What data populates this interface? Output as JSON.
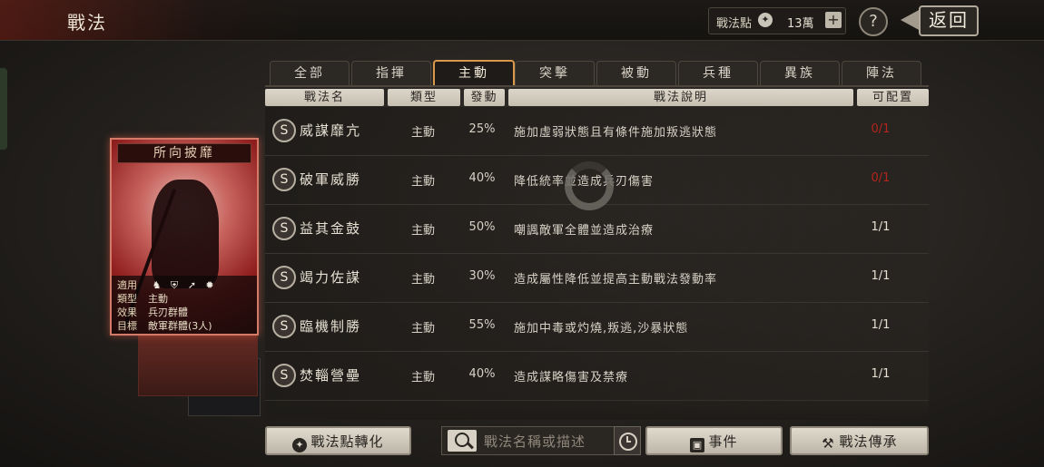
{
  "header": {
    "title": "戰法",
    "points_label": "戰法點",
    "points_value": "13萬",
    "plus_label": "+",
    "help_label": "?",
    "back_label": "返回"
  },
  "tabs": [
    {
      "label": "全部"
    },
    {
      "label": "指揮"
    },
    {
      "label": "主動"
    },
    {
      "label": "突擊"
    },
    {
      "label": "被動"
    },
    {
      "label": "兵種"
    },
    {
      "label": "異族"
    },
    {
      "label": "陣法"
    }
  ],
  "active_tab": "主動",
  "columns": {
    "name": "戰法名",
    "type": "類型",
    "rate": "發動",
    "desc": "戰法說明",
    "avail": "可配置"
  },
  "rows": [
    {
      "badge": "S",
      "name": "威謀靡亢",
      "type": "主動",
      "rate": "25%",
      "desc": "施加虛弱狀態且有條件施加叛逃狀態",
      "avail": "0/1",
      "avail_color": "#b3241c"
    },
    {
      "badge": "S",
      "name": "破軍威勝",
      "type": "主動",
      "rate": "40%",
      "desc": "降低統率並造成兵刃傷害",
      "avail": "0/1",
      "avail_color": "#b3241c"
    },
    {
      "badge": "S",
      "name": "益其金鼓",
      "type": "主動",
      "rate": "50%",
      "desc": "嘲諷敵軍全體並造成治療",
      "avail": "1/1",
      "avail_color": "#e6e0d2"
    },
    {
      "badge": "S",
      "name": "竭力佐謀",
      "type": "主動",
      "rate": "30%",
      "desc": "造成屬性降低並提高主動戰法發動率",
      "avail": "1/1",
      "avail_color": "#e6e0d2"
    },
    {
      "badge": "S",
      "name": "臨機制勝",
      "type": "主動",
      "rate": "55%",
      "desc": "施加中毒或灼燒,叛逃,沙暴狀態",
      "avail": "1/1",
      "avail_color": "#e6e0d2"
    },
    {
      "badge": "S",
      "name": "焚輜營壘",
      "type": "主動",
      "rate": "40%",
      "desc": "造成謀略傷害及禁療",
      "avail": "1/1",
      "avail_color": "#e6e0d2"
    }
  ],
  "card": {
    "title": "所向披靡",
    "apply_key": "適用",
    "type_key": "類型",
    "type_value": "主動",
    "effect_key": "效果",
    "effect_value": "兵刃群體",
    "target_key": "目標",
    "target_value": "敵軍群體(3人)",
    "unit_icons": [
      "cavalry-icon",
      "shield-icon",
      "archer-icon",
      "chariot-icon"
    ]
  },
  "bottom": {
    "convert_label": "戰法點轉化",
    "search_placeholder": "戰法名稱或描述",
    "event_label": "事件",
    "inherit_label": "戰法傳承"
  },
  "colors": {
    "accent_active_tab": "#d89a4a",
    "unavailable_red": "#b3241c",
    "card_red": "#8f1e1e"
  }
}
